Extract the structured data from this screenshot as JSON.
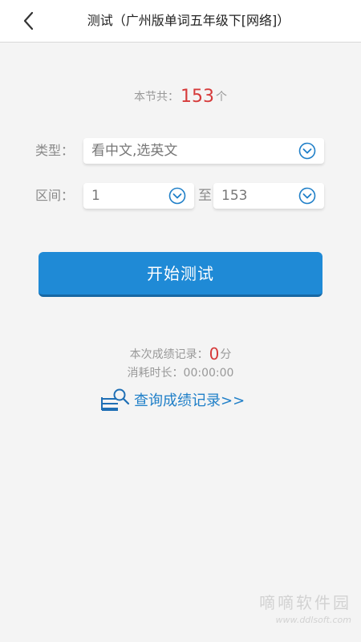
{
  "header": {
    "back_icon": "chevron-left-icon",
    "title": "测试（广州版单词五年级下[网络]）"
  },
  "summary": {
    "prefix": "本节共：",
    "count": "153",
    "suffix": "个"
  },
  "type_row": {
    "label": "类型：",
    "value": "看中文,选英文",
    "icon": "chevron-down-circle-icon"
  },
  "range_row": {
    "label": "区间：",
    "start": "1",
    "separator": "至",
    "end": "153"
  },
  "start_button": {
    "label": "开始测试",
    "color": "#1f8ad6"
  },
  "results": {
    "score_prefix": "本次成绩记录：",
    "score": "0",
    "score_suffix": "分",
    "time_label": "消耗时长：",
    "time_value": "00:00:00"
  },
  "records_link": {
    "icon": "search-document-icon",
    "label": "查询成绩记录>>"
  },
  "watermark": {
    "name": "嘀嘀软件园",
    "url": "www.ddlsoft.com"
  },
  "colors": {
    "accent": "#1f8ad6",
    "highlight_number": "#d63a3a",
    "link": "#1f7fc8"
  }
}
